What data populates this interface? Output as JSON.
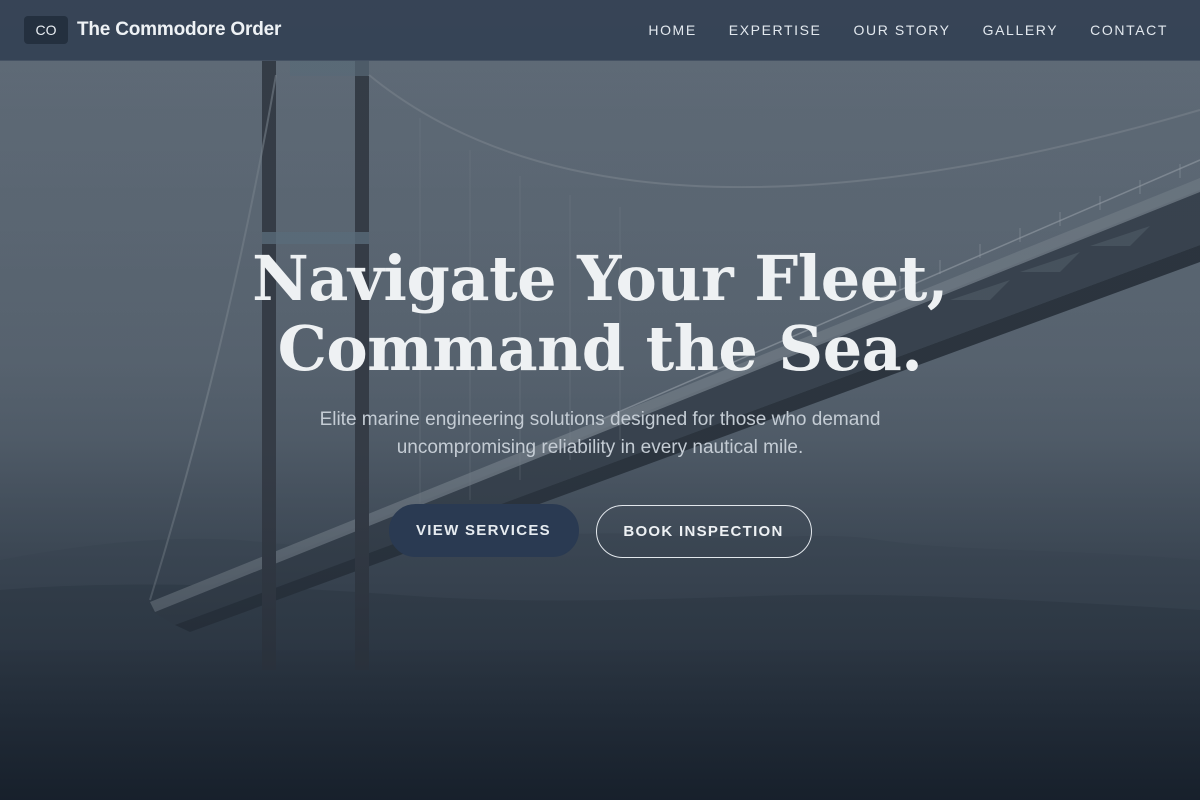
{
  "header": {
    "logo_text": "CO",
    "brand_name": "The Commodore Order",
    "nav": [
      {
        "label": "HOME"
      },
      {
        "label": "EXPERTISE"
      },
      {
        "label": "OUR STORY"
      },
      {
        "label": "GALLERY"
      },
      {
        "label": "CONTACT"
      }
    ]
  },
  "hero": {
    "title_line1": "Navigate Your Fleet,",
    "title_line2": "Command the Sea.",
    "subtitle_line1": "Elite marine engineering solutions designed for those who demand",
    "subtitle_line2": "uncompromising reliability in every nautical mile.",
    "primary_cta": "VIEW SERVICES",
    "secondary_cta": "BOOK INSPECTION",
    "background_image": "suspension-bridge-over-water",
    "overlay_color": "#1c2633"
  },
  "colors": {
    "header_bg": "#344254",
    "primary_button": "#2a3a52",
    "text_light": "#eef1f3",
    "text_muted": "#c4ccd4"
  }
}
